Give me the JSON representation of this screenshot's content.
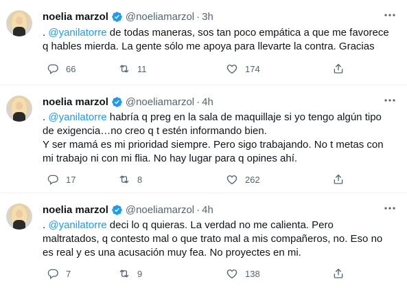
{
  "tweets": [
    {
      "name": "noelia marzol",
      "handle": "@noeliamarzol",
      "separator": "·",
      "time": "3h",
      "text_prefix": ". ",
      "mention": "@yanilatorre",
      "line1_rest": " de todas maneras, sos tan poco empática a que me favorece",
      "lines": [
        "q hables mierda. La gente sólo me apoya para llevarte la contra. Gracias"
      ],
      "replies": "66",
      "retweets": "11",
      "likes": "174"
    },
    {
      "name": "noelia marzol",
      "handle": "@noeliamarzol",
      "separator": "·",
      "time": "4h",
      "text_prefix": ". ",
      "mention": "@yanilatorre",
      "line1_rest": " habría q preg en la sala de maquillaje si yo tengo algún tipo",
      "lines": [
        "de exigencia…no creo q t estén informando bien.",
        "Y ser mamá es mi prioridad siempre. Pero sigo trabajando. No t metas con",
        "mi trabajo ni con mi flia. No hay lugar para q opines ahí."
      ],
      "replies": "17",
      "retweets": "8",
      "likes": "262"
    },
    {
      "name": "noelia marzol",
      "handle": "@noeliamarzol",
      "separator": "·",
      "time": "4h",
      "text_prefix": ". ",
      "mention": "@yanilatorre",
      "line1_rest": " deci lo q quieras. La verdad no me calienta. Pero",
      "lines": [
        "maltratados, q contesto mal o que trato mal a mis compañeros, no. Eso no",
        "es real y es una acusación muy fea. No proyectes en mi."
      ],
      "replies": "7",
      "retweets": "9",
      "likes": "138"
    }
  ],
  "icons": {
    "verified": "verified-badge-icon",
    "more": "more-options-icon",
    "reply": "reply-icon",
    "retweet": "retweet-icon",
    "like": "heart-icon",
    "share": "share-icon"
  },
  "colors": {
    "accent": "#1d9bf0",
    "text": "#0f1419",
    "secondary": "#536471",
    "divider": "#eff3f4"
  }
}
